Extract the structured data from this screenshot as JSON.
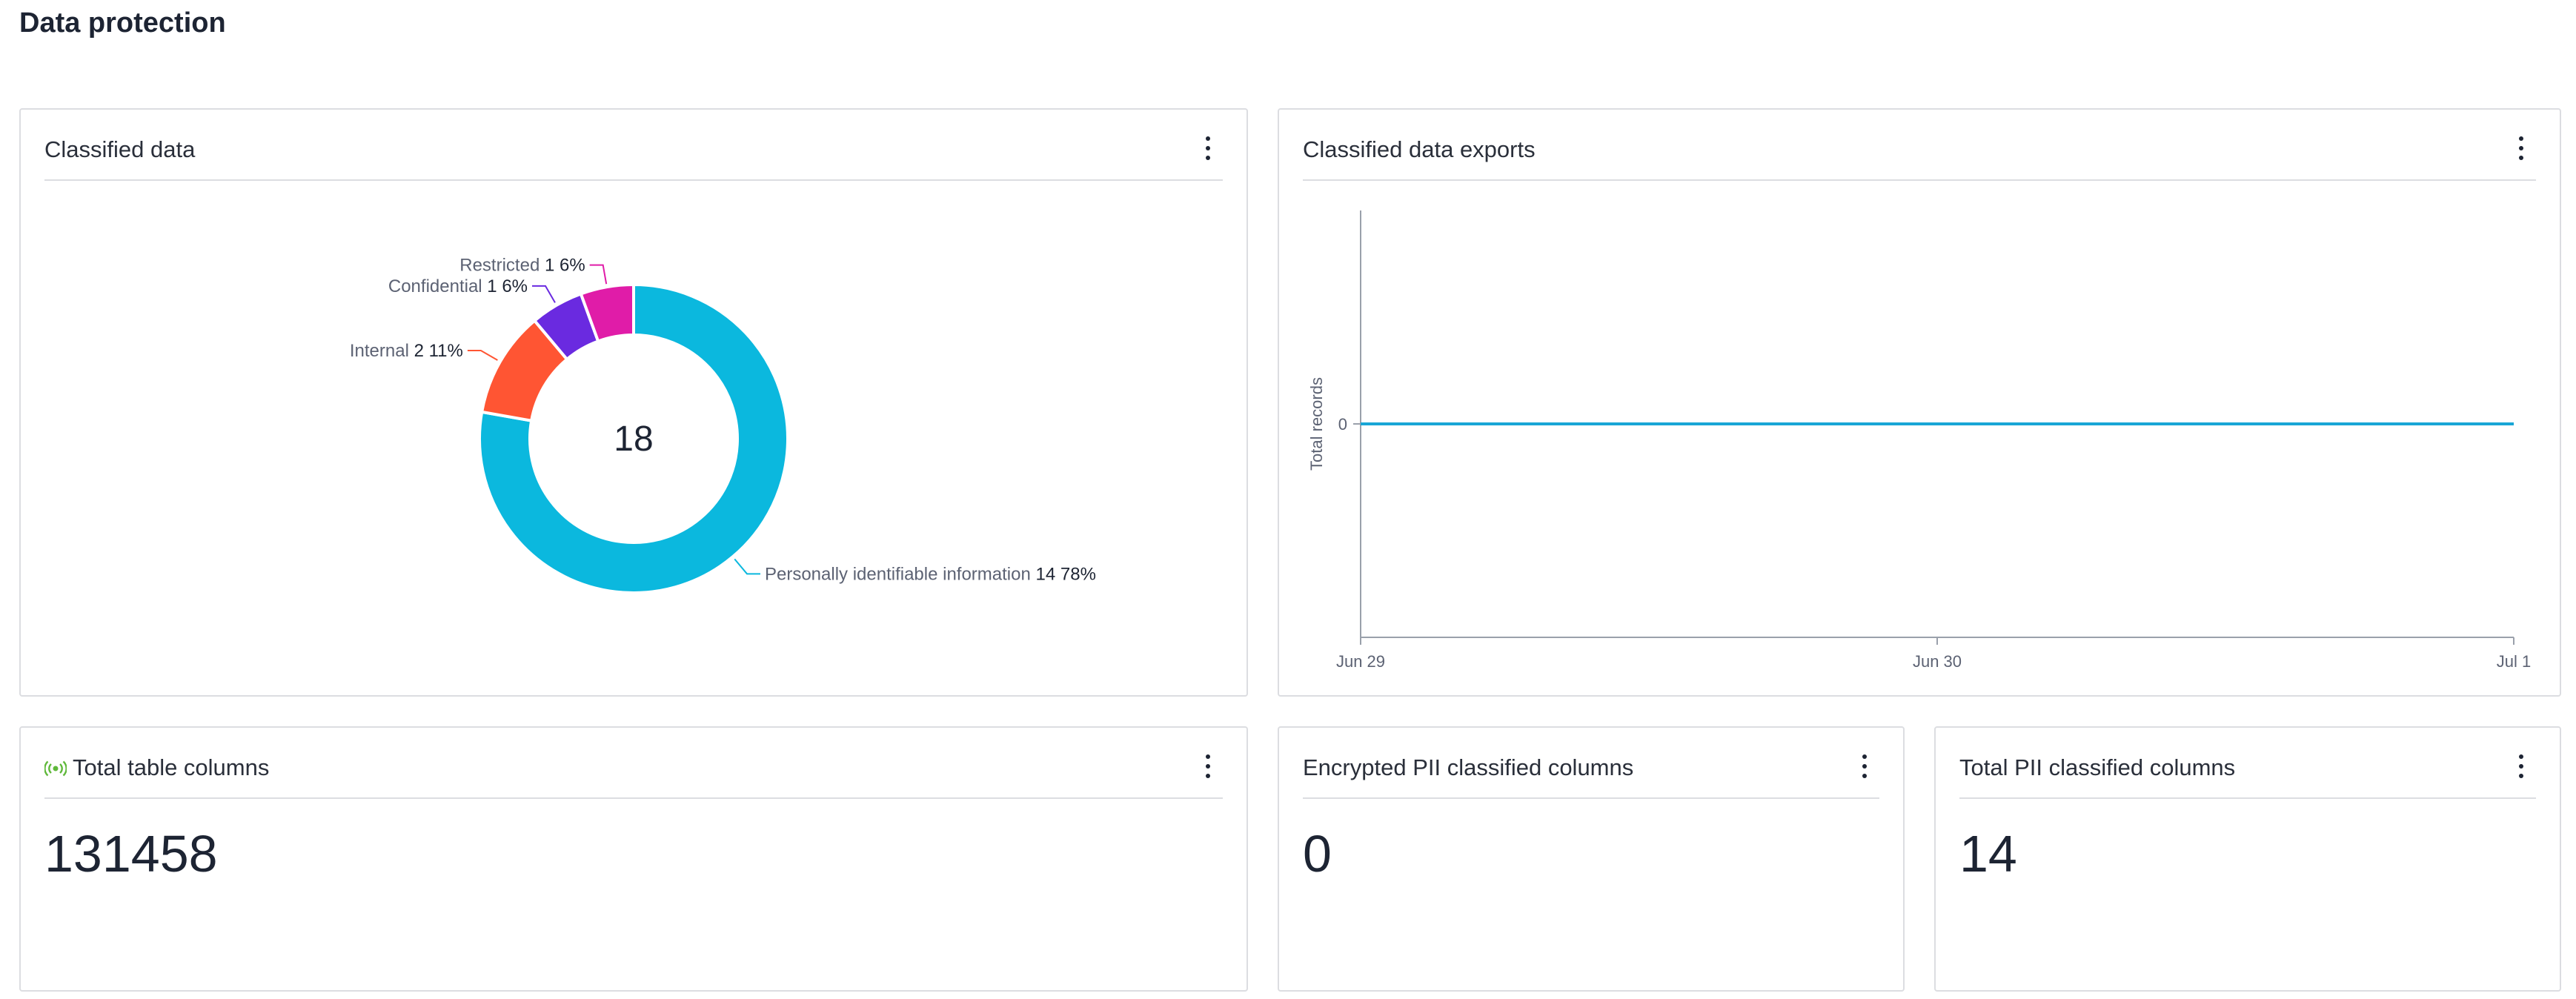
{
  "page": {
    "title": "Data protection"
  },
  "cards": {
    "classified_data": {
      "title": "Classified data",
      "total": "18"
    },
    "classified_data_exports": {
      "title": "Classified data exports"
    },
    "total_table_columns": {
      "title": "Total table columns",
      "value": "131458"
    },
    "encrypted_pii": {
      "title": "Encrypted PII classified columns",
      "value": "0"
    },
    "total_pii": {
      "title": "Total PII classified columns",
      "value": "14"
    }
  },
  "icons": {
    "card_menu": "more-vertical-icon",
    "live": "live-signal-icon"
  },
  "colors": {
    "pii": "#0bb8de",
    "internal": "#ff5533",
    "confidential": "#6a2ae0",
    "restricted": "#e01ca8",
    "line": "#19a6d6",
    "live": "#5fb83a"
  },
  "chart_data": [
    {
      "type": "pie",
      "title": "Classified data",
      "center_label": "18",
      "slices": [
        {
          "label": "Personally identifiable information",
          "value": 14,
          "percent": "78%",
          "color": "#0bb8de"
        },
        {
          "label": "Internal",
          "value": 2,
          "percent": "11%",
          "color": "#ff5533"
        },
        {
          "label": "Confidential",
          "value": 1,
          "percent": "6%",
          "color": "#6a2ae0"
        },
        {
          "label": "Restricted",
          "value": 1,
          "percent": "6%",
          "color": "#e01ca8"
        }
      ]
    },
    {
      "type": "line",
      "title": "Classified data exports",
      "ylabel": "Total records",
      "xlabel": "",
      "x": [
        "Jun 29",
        "Jun 30",
        "Jul 1"
      ],
      "yticks": [
        0
      ],
      "series": [
        {
          "values": [
            0,
            0,
            0
          ]
        }
      ]
    }
  ]
}
